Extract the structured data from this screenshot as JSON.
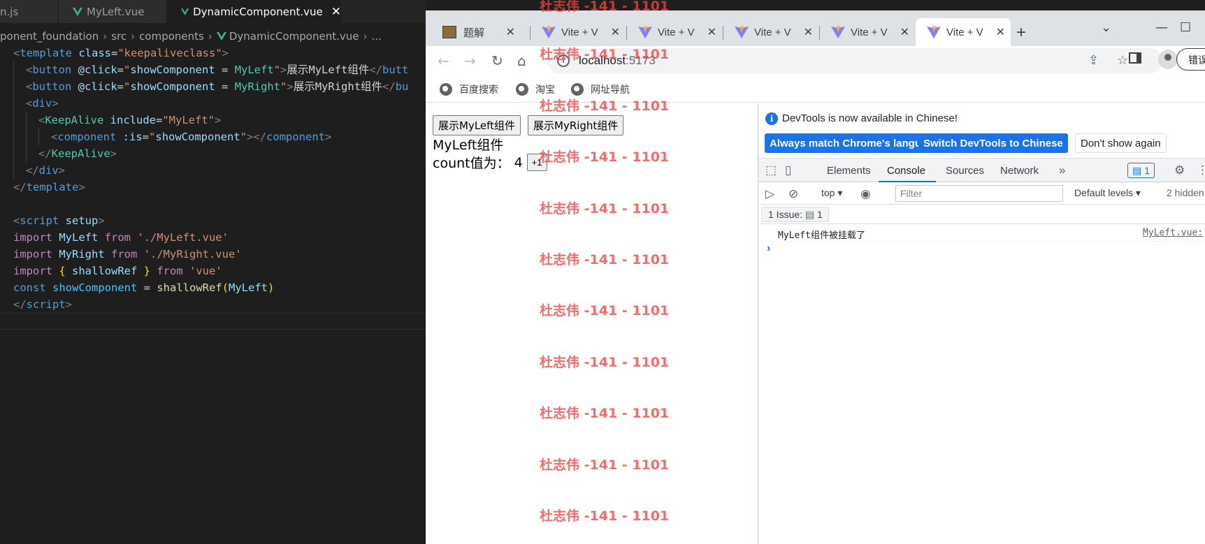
{
  "editor": {
    "tabs": [
      {
        "label": "n.js",
        "icon": "js-file-icon"
      },
      {
        "label": "MyLeft.vue",
        "icon": "vue-file-icon"
      },
      {
        "label": "DynamicComponent.vue",
        "icon": "vue-file-icon",
        "active": true
      }
    ],
    "breadcrumb": [
      "ponent_foundation",
      "src",
      "components",
      "DynamicComponent.vue",
      "..."
    ],
    "code_lines": [
      [
        {
          "t": "<",
          "c": "#808080"
        },
        {
          "t": "template",
          "c": "#569cd6"
        },
        {
          "t": " class",
          "c": "#9cdcfe"
        },
        {
          "t": "=",
          "c": "#d4d4d4"
        },
        {
          "t": "\"keepaliveclass\"",
          "c": "#ce9178"
        },
        {
          "t": ">",
          "c": "#808080"
        }
      ],
      [
        {
          "t": "<",
          "c": "#808080"
        },
        {
          "t": "button",
          "c": "#569cd6"
        },
        {
          "t": " @click",
          "c": "#9cdcfe"
        },
        {
          "t": "=",
          "c": "#d4d4d4"
        },
        {
          "t": "\"",
          "c": "#ce9178"
        },
        {
          "t": "showComponent",
          "c": "#9cdcfe"
        },
        {
          "t": " = ",
          "c": "#d4d4d4"
        },
        {
          "t": "MyLeft",
          "c": "#4ec9b0"
        },
        {
          "t": "\"",
          "c": "#ce9178"
        },
        {
          "t": ">",
          "c": "#808080"
        },
        {
          "t": "展示MyLeft组件",
          "c": "#d4d4d4"
        },
        {
          "t": "</",
          "c": "#808080"
        },
        {
          "t": "butt",
          "c": "#569cd6"
        }
      ],
      [
        {
          "t": "<",
          "c": "#808080"
        },
        {
          "t": "button",
          "c": "#569cd6"
        },
        {
          "t": " @click",
          "c": "#9cdcfe"
        },
        {
          "t": "=",
          "c": "#d4d4d4"
        },
        {
          "t": "\"",
          "c": "#ce9178"
        },
        {
          "t": "showComponent",
          "c": "#9cdcfe"
        },
        {
          "t": " = ",
          "c": "#d4d4d4"
        },
        {
          "t": "MyRight",
          "c": "#4ec9b0"
        },
        {
          "t": "\"",
          "c": "#ce9178"
        },
        {
          "t": ">",
          "c": "#808080"
        },
        {
          "t": "展示MyRight组件",
          "c": "#d4d4d4"
        },
        {
          "t": "</",
          "c": "#808080"
        },
        {
          "t": "bu",
          "c": "#569cd6"
        }
      ],
      [
        {
          "t": "<",
          "c": "#808080"
        },
        {
          "t": "div",
          "c": "#569cd6"
        },
        {
          "t": ">",
          "c": "#808080"
        }
      ],
      [
        {
          "t": "<",
          "c": "#808080"
        },
        {
          "t": "KeepAlive",
          "c": "#4ec9b0"
        },
        {
          "t": " include",
          "c": "#9cdcfe"
        },
        {
          "t": "=",
          "c": "#d4d4d4"
        },
        {
          "t": "\"MyLeft\"",
          "c": "#ce9178"
        },
        {
          "t": ">",
          "c": "#808080"
        }
      ],
      [
        {
          "t": "<",
          "c": "#808080"
        },
        {
          "t": "component",
          "c": "#569cd6"
        },
        {
          "t": " :is",
          "c": "#9cdcfe"
        },
        {
          "t": "=",
          "c": "#d4d4d4"
        },
        {
          "t": "\"",
          "c": "#ce9178"
        },
        {
          "t": "showComponent",
          "c": "#9cdcfe"
        },
        {
          "t": "\"",
          "c": "#ce9178"
        },
        {
          "t": "></",
          "c": "#808080"
        },
        {
          "t": "component",
          "c": "#569cd6"
        },
        {
          "t": ">",
          "c": "#808080"
        }
      ],
      [
        {
          "t": "</",
          "c": "#808080"
        },
        {
          "t": "KeepAlive",
          "c": "#4ec9b0"
        },
        {
          "t": ">",
          "c": "#808080"
        }
      ],
      [
        {
          "t": "</",
          "c": "#808080"
        },
        {
          "t": "div",
          "c": "#569cd6"
        },
        {
          "t": ">",
          "c": "#808080"
        }
      ],
      [
        {
          "t": "</",
          "c": "#808080"
        },
        {
          "t": "template",
          "c": "#569cd6"
        },
        {
          "t": ">",
          "c": "#808080"
        }
      ],
      [],
      [
        {
          "t": "<",
          "c": "#808080"
        },
        {
          "t": "script",
          "c": "#569cd6"
        },
        {
          "t": " setup",
          "c": "#9cdcfe"
        },
        {
          "t": ">",
          "c": "#808080"
        }
      ],
      [
        {
          "t": "import",
          "c": "#c586c0"
        },
        {
          "t": " MyLeft ",
          "c": "#9cdcfe"
        },
        {
          "t": "from",
          "c": "#c586c0"
        },
        {
          "t": " './MyLeft.vue'",
          "c": "#ce9178"
        }
      ],
      [
        {
          "t": "import",
          "c": "#c586c0"
        },
        {
          "t": " MyRight ",
          "c": "#9cdcfe"
        },
        {
          "t": "from",
          "c": "#c586c0"
        },
        {
          "t": " './MyRight.vue'",
          "c": "#ce9178"
        }
      ],
      [
        {
          "t": "import",
          "c": "#c586c0"
        },
        {
          "t": " { ",
          "c": "#ffd700"
        },
        {
          "t": "shallowRef",
          "c": "#9cdcfe"
        },
        {
          "t": " } ",
          "c": "#ffd700"
        },
        {
          "t": "from",
          "c": "#c586c0"
        },
        {
          "t": " 'vue'",
          "c": "#ce9178"
        }
      ],
      [
        {
          "t": "const",
          "c": "#569cd6"
        },
        {
          "t": " showComponent",
          "c": "#4fc1ff"
        },
        {
          "t": " = ",
          "c": "#d4d4d4"
        },
        {
          "t": "shallowRef",
          "c": "#dcdcaa"
        },
        {
          "t": "(",
          "c": "#ffd700"
        },
        {
          "t": "MyLeft",
          "c": "#9cdcfe"
        },
        {
          "t": ")",
          "c": "#ffd700"
        }
      ],
      [
        {
          "t": "</",
          "c": "#808080"
        },
        {
          "t": "script",
          "c": "#569cd6"
        },
        {
          "t": ">",
          "c": "#808080"
        }
      ],
      []
    ],
    "indent_levels": [
      0,
      1,
      1,
      1,
      2,
      3,
      2,
      1,
      0,
      0,
      0,
      0,
      0,
      0,
      0,
      0,
      0
    ]
  },
  "browser": {
    "tabs": [
      {
        "label": "题解",
        "icon": "leetcode-favicon-icon"
      },
      {
        "label": "Vite + V",
        "icon": "vite-logo-icon"
      },
      {
        "label": "Vite + V",
        "icon": "vite-logo-icon"
      },
      {
        "label": "Vite + V",
        "icon": "vite-logo-icon"
      },
      {
        "label": "Vite + V",
        "icon": "vite-logo-icon"
      },
      {
        "label": "Vite + V",
        "icon": "vite-logo-icon",
        "active": true
      }
    ],
    "url_host": "localhost",
    "url_port": ":5173",
    "error_button": "错误",
    "bookmarks": [
      "百度搜索",
      "淘宝",
      "网址导航"
    ]
  },
  "page": {
    "btn_left": "展示MyLeft组件",
    "btn_right": "展示MyRight组件",
    "heading": "MyLeft组件",
    "count_label": "count值为：",
    "count_value": "4",
    "inc_label": "+1"
  },
  "devtools": {
    "info_text": "DevTools is now available in Chinese!",
    "btn_match": "Always match Chrome's language",
    "btn_switch": "Switch DevTools to Chinese",
    "btn_dismiss": "Don't show again",
    "tabs": [
      "Elements",
      "Console",
      "Sources",
      "Network"
    ],
    "active_tab": "Console",
    "message_count": "1",
    "context": "top",
    "filter_placeholder": "Filter",
    "levels": "Default levels",
    "hidden": "2 hidden",
    "issues_label": "1 Issue:",
    "issues_count": "1",
    "message": "MyLeft组件被挂载了",
    "message_source": "MyLeft.vue:"
  },
  "watermark": {
    "text": "杜志伟 -141 - 1101",
    "color": "#ef4444"
  },
  "colors": {
    "editor_bg": "#1e1e1e",
    "vue_green": "#41b883",
    "chrome_blue": "#1a73e8"
  }
}
